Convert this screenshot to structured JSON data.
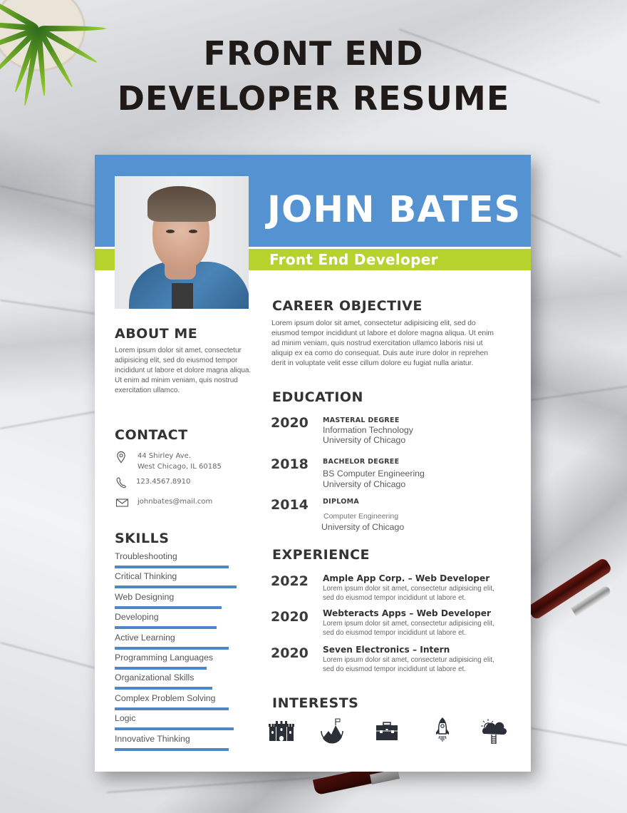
{
  "poster": {
    "title_line1": "FRONT END",
    "title_line2": "DEVELOPER RESUME"
  },
  "colors": {
    "header_blue": "#5592d2",
    "accent_green": "#b5d32c",
    "skill_bar": "#4f86c6",
    "heading_text": "#333333"
  },
  "profile": {
    "name": "JOHN BATES",
    "role": "Front End Developer",
    "photo_alt": "Portrait photo of John Bates"
  },
  "about": {
    "heading": "ABOUT ME",
    "text": "Lorem ipsum dolor sit amet, consectetur adipisicing elit, sed do eiusmod tempor incididunt ut labore et dolore magna aliqua. Ut enim ad minim veniam, quis nostrud exercitation ullamco."
  },
  "contact": {
    "heading": "CONTACT",
    "address_line1": "44 Shirley Ave.",
    "address_line2": "West Chicago, IL 60185",
    "phone": "123.4567.8910",
    "email": "johnbates@mail.com",
    "icons": [
      "location-pin-icon",
      "phone-icon",
      "mail-icon"
    ]
  },
  "skills": {
    "heading": "SKILLS",
    "items": [
      {
        "label": "Troubleshooting",
        "level": 0.84
      },
      {
        "label": "Critical Thinking",
        "level": 0.9
      },
      {
        "label": "Web Designing",
        "level": 0.79
      },
      {
        "label": "Developing",
        "level": 0.75
      },
      {
        "label": "Active Learning",
        "level": 0.84
      },
      {
        "label": "Programming Languages",
        "level": 0.68
      },
      {
        "label": "Organizational Skills",
        "level": 0.72
      },
      {
        "label": "Complex Problem Solving",
        "level": 0.84
      },
      {
        "label": "Logic",
        "level": 0.88
      },
      {
        "label": "Innovative Thinking",
        "level": 0.84
      }
    ]
  },
  "career": {
    "heading": "CAREER OBJECTIVE",
    "lines": [
      "Lorem ipsum dolor sit amet, consectetur adipisicing elit, sed do",
      "eiusmod tempor incididunt ut labore et dolore magna aliqua. Ut enim",
      "ad minim veniam, quis nostrud exercitation ullamco laboris nisi ut",
      "aliquip ex ea como do consequat. Duis aute irure dolor in reprehen",
      "derit in voluptate velit esse cillum dolore eu fugiat nulla ariatur."
    ]
  },
  "education": {
    "heading": "EDUCATION",
    "items": [
      {
        "year": "2020",
        "title": "MASTERAL DEGREE",
        "line1": "Information Technology",
        "line2": "University of Chicago"
      },
      {
        "year": "2018",
        "title": "BACHELOR DEGREE",
        "line1": "BS Computer Engineering",
        "line2": "University of Chicago"
      },
      {
        "year": "2014",
        "title": "DIPLOMA",
        "line1": "Computer Engineering",
        "line2": "University of Chicago"
      }
    ]
  },
  "experience": {
    "heading": "EXPERIENCE",
    "items": [
      {
        "year": "2022",
        "title": "Ample App Corp. – Web Developer",
        "line1": "Lorem ipsum dolor sit amet, consectetur adipisicing elit,",
        "line2": "sed do eiusmod tempor incididunt ut labore et."
      },
      {
        "year": "2020",
        "title": "Webteracts Apps – Web Developer",
        "line1": "Lorem ipsum dolor sit amet, consectetur adipisicing elit,",
        "line2": "sed do eiusmod tempor incididunt ut labore et."
      },
      {
        "year": "2020",
        "title": "Seven Electronics – Intern",
        "line1": "Lorem ipsum dolor sit amet, consectetur adipisicing elit,",
        "line2": "sed do eiusmod tempor incididunt ut labore et."
      }
    ]
  },
  "interests": {
    "heading": "INTERESTS",
    "icons": [
      "castle-icon",
      "mountain-flag-icon",
      "briefcase-icon",
      "rocket-icon",
      "cloud-sun-ladder-icon"
    ]
  }
}
